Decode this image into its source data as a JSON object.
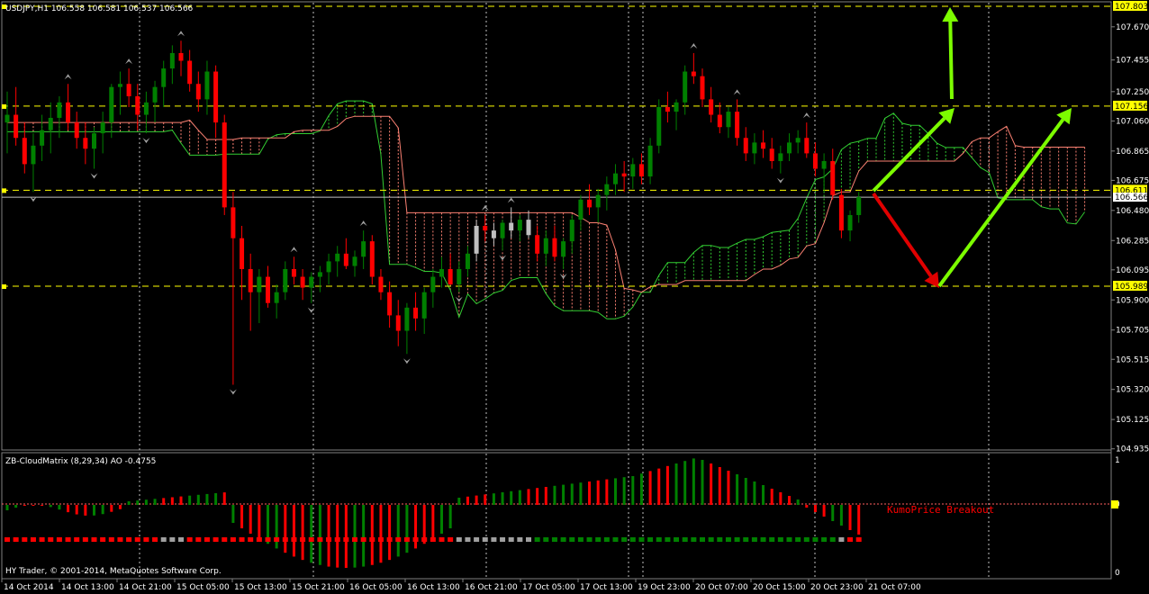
{
  "header": {
    "symbol_line": "USDJPY,H1  106.558 106.581 106.537 106.566"
  },
  "indicator": {
    "label": "ZB-CloudMatrix (8,29,34)  AO -0.4755",
    "annotation": "KumoPrice Breakout",
    "scale_top": "1",
    "scale_mid": "0",
    "scale_bottom": "0"
  },
  "footer": {
    "copyright": "HY Trader, © 2001-2014, MetaQuotes Software Corp."
  },
  "colors": {
    "background": "#000000",
    "bull": "#008000",
    "bear": "#ff0000",
    "doji": "#c0c0c0",
    "cloud_up": "#32cd32",
    "cloud_down": "#fa8072",
    "level": "#ffff00",
    "arrow_up": "#7cfc00",
    "arrow_down": "#e00000"
  },
  "price_axis": {
    "ticks": [
      "107.670",
      "107.455",
      "107.250",
      "107.060",
      "106.865",
      "106.675",
      "106.480",
      "106.285",
      "106.095",
      "105.900",
      "105.705",
      "105.515",
      "105.320",
      "105.125",
      "104.935"
    ],
    "current": "106.566"
  },
  "levels": [
    {
      "price": 107.803,
      "label": "107.803"
    },
    {
      "price": 107.156,
      "label": "107.156"
    },
    {
      "price": 106.611,
      "label": "106.611"
    },
    {
      "price": 105.989,
      "label": "105.989"
    }
  ],
  "time_axis": {
    "labels": [
      "14 Oct 2014",
      "14 Oct 13:00",
      "14 Oct 21:00",
      "15 Oct 05:00",
      "15 Oct 13:00",
      "15 Oct 21:00",
      "16 Oct 05:00",
      "16 Oct 13:00",
      "16 Oct 21:00",
      "17 Oct 05:00",
      "17 Oct 13:00",
      "19 Oct 23:00",
      "20 Oct 07:00",
      "20 Oct 15:00",
      "20 Oct 23:00",
      "21 Oct 07:00"
    ]
  },
  "chart_data": {
    "type": "candlestick",
    "symbol": "USDJPY",
    "timeframe": "H1",
    "ylim": [
      104.935,
      107.803
    ],
    "candles": [
      [
        107.05,
        107.25,
        106.85,
        107.1
      ],
      [
        107.1,
        107.28,
        106.9,
        106.95
      ],
      [
        106.95,
        107.05,
        106.72,
        106.78
      ],
      [
        106.78,
        106.98,
        106.6,
        106.9
      ],
      [
        106.9,
        107.1,
        106.8,
        107.0
      ],
      [
        107.0,
        107.18,
        106.85,
        107.08
      ],
      [
        107.08,
        107.22,
        106.95,
        107.18
      ],
      [
        107.18,
        107.3,
        107.0,
        107.05
      ],
      [
        107.05,
        107.12,
        106.88,
        106.95
      ],
      [
        106.95,
        107.05,
        106.78,
        106.88
      ],
      [
        106.88,
        107.02,
        106.75,
        106.98
      ],
      [
        106.98,
        107.12,
        106.85,
        107.05
      ],
      [
        107.05,
        107.3,
        106.95,
        107.28
      ],
      [
        107.28,
        107.38,
        107.1,
        107.3
      ],
      [
        107.3,
        107.4,
        107.15,
        107.22
      ],
      [
        107.22,
        107.3,
        107.0,
        107.1
      ],
      [
        107.1,
        107.25,
        106.98,
        107.18
      ],
      [
        107.18,
        107.32,
        107.05,
        107.28
      ],
      [
        107.28,
        107.45,
        107.15,
        107.4
      ],
      [
        107.4,
        107.55,
        107.3,
        107.5
      ],
      [
        107.5,
        107.58,
        107.35,
        107.45
      ],
      [
        107.45,
        107.52,
        107.25,
        107.3
      ],
      [
        107.3,
        107.38,
        107.12,
        107.2
      ],
      [
        107.2,
        107.45,
        107.1,
        107.38
      ],
      [
        107.38,
        107.42,
        106.95,
        107.05
      ],
      [
        107.05,
        107.1,
        106.45,
        106.5
      ],
      [
        106.5,
        106.6,
        105.35,
        106.3
      ],
      [
        106.3,
        106.38,
        105.9,
        106.1
      ],
      [
        106.1,
        106.2,
        105.7,
        105.95
      ],
      [
        105.95,
        106.1,
        105.75,
        106.05
      ],
      [
        106.05,
        106.12,
        105.85,
        105.88
      ],
      [
        105.88,
        106.0,
        105.78,
        105.95
      ],
      [
        105.95,
        106.15,
        105.9,
        106.1
      ],
      [
        106.1,
        106.18,
        106.0,
        106.05
      ],
      [
        106.05,
        106.1,
        105.9,
        105.98
      ],
      [
        105.98,
        106.08,
        105.88,
        106.05
      ],
      [
        106.05,
        106.12,
        105.95,
        106.08
      ],
      [
        106.08,
        106.2,
        106.0,
        106.15
      ],
      [
        106.15,
        106.25,
        106.05,
        106.2
      ],
      [
        106.2,
        106.3,
        106.1,
        106.12
      ],
      [
        106.12,
        106.22,
        106.05,
        106.18
      ],
      [
        106.18,
        106.35,
        106.1,
        106.28
      ],
      [
        106.28,
        106.32,
        106.0,
        106.05
      ],
      [
        106.05,
        106.1,
        105.9,
        105.95
      ],
      [
        105.95,
        106.02,
        105.72,
        105.8
      ],
      [
        105.8,
        105.9,
        105.6,
        105.7
      ],
      [
        105.7,
        105.88,
        105.55,
        105.85
      ],
      [
        105.85,
        105.95,
        105.7,
        105.78
      ],
      [
        105.78,
        105.98,
        105.68,
        105.95
      ],
      [
        105.95,
        106.1,
        105.85,
        106.05
      ],
      [
        106.05,
        106.18,
        105.98,
        106.1
      ],
      [
        106.1,
        106.2,
        106.0,
        106.0
      ],
      [
        106.0,
        106.15,
        105.95,
        106.1
      ],
      [
        106.1,
        106.25,
        106.05,
        106.2
      ],
      [
        106.2,
        106.42,
        106.15,
        106.38
      ],
      [
        106.38,
        106.45,
        106.28,
        106.35
      ],
      [
        106.35,
        106.4,
        106.25,
        106.3
      ],
      [
        106.3,
        106.42,
        106.22,
        106.4
      ],
      [
        106.4,
        106.5,
        106.3,
        106.35
      ],
      [
        106.35,
        106.45,
        106.28,
        106.42
      ],
      [
        106.42,
        106.48,
        106.3,
        106.32
      ],
      [
        106.32,
        106.38,
        106.15,
        106.2
      ],
      [
        106.2,
        106.35,
        106.12,
        106.3
      ],
      [
        106.3,
        106.38,
        106.15,
        106.18
      ],
      [
        106.18,
        106.3,
        106.1,
        106.28
      ],
      [
        106.28,
        106.45,
        106.2,
        106.42
      ],
      [
        106.42,
        106.58,
        106.35,
        106.55
      ],
      [
        106.55,
        106.65,
        106.45,
        106.5
      ],
      [
        106.5,
        106.62,
        106.4,
        106.58
      ],
      [
        106.58,
        106.7,
        106.48,
        106.65
      ],
      [
        106.65,
        106.78,
        106.58,
        106.72
      ],
      [
        106.72,
        106.8,
        106.6,
        106.7
      ],
      [
        106.7,
        106.82,
        106.62,
        106.78
      ],
      [
        106.78,
        106.85,
        106.65,
        106.7
      ],
      [
        106.7,
        106.95,
        106.65,
        106.9
      ],
      [
        106.9,
        107.2,
        106.85,
        107.15
      ],
      [
        107.15,
        107.25,
        107.05,
        107.12
      ],
      [
        107.12,
        107.2,
        107.0,
        107.18
      ],
      [
        107.18,
        107.42,
        107.1,
        107.38
      ],
      [
        107.38,
        107.5,
        107.3,
        107.35
      ],
      [
        107.35,
        107.4,
        107.15,
        107.2
      ],
      [
        107.2,
        107.28,
        107.05,
        107.1
      ],
      [
        107.1,
        107.18,
        106.98,
        107.02
      ],
      [
        107.02,
        107.15,
        106.95,
        107.12
      ],
      [
        107.12,
        107.2,
        106.9,
        106.95
      ],
      [
        106.95,
        107.02,
        106.8,
        106.85
      ],
      [
        106.85,
        106.98,
        106.78,
        106.92
      ],
      [
        106.92,
        107.0,
        106.82,
        106.88
      ],
      [
        106.88,
        106.95,
        106.75,
        106.8
      ],
      [
        106.8,
        106.9,
        106.72,
        106.85
      ],
      [
        106.85,
        106.98,
        106.8,
        106.92
      ],
      [
        106.92,
        107.0,
        106.85,
        106.95
      ],
      [
        106.95,
        107.05,
        106.82,
        106.85
      ],
      [
        106.85,
        106.92,
        106.7,
        106.75
      ],
      [
        106.75,
        106.85,
        106.6,
        106.8
      ],
      [
        106.8,
        106.88,
        106.55,
        106.58
      ],
      [
        106.58,
        106.62,
        106.3,
        106.35
      ],
      [
        106.35,
        106.48,
        106.28,
        106.45
      ],
      [
        106.45,
        106.6,
        106.4,
        106.566
      ]
    ]
  }
}
